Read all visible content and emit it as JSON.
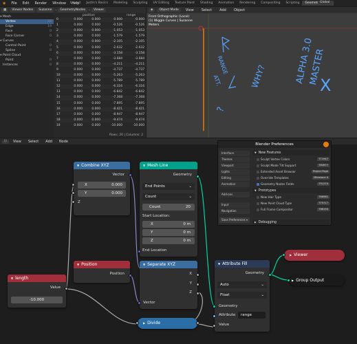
{
  "menubar": {
    "items": [
      "File",
      "Edit",
      "Render",
      "Window",
      "Help"
    ]
  },
  "workspace_tabs": [
    "Layout",
    "Justin's Basics",
    "Modeling",
    "Sculpting",
    "UV Editing",
    "Texture Paint",
    "Shading",
    "Animation",
    "Rendering",
    "Compositing",
    "Scripting",
    "Geometry Nodes"
  ],
  "scene": {
    "label": "Global"
  },
  "spreadsheet": {
    "editor": "Viewer Nodes",
    "object": "Suzanne",
    "node": "GeometryNodes",
    "viewer": "Viewer",
    "domains": [
      {
        "label": "Mesh",
        "group": true
      },
      {
        "label": "Vertex",
        "count": "20",
        "selected": true
      },
      {
        "label": "Edge",
        "count": "19"
      },
      {
        "label": "Face",
        "count": "0"
      },
      {
        "label": "Face Corner",
        "count": "0"
      },
      {
        "label": "Curves",
        "group": true
      },
      {
        "label": "Control Point",
        "count": "0"
      },
      {
        "label": "Spline",
        "count": "0"
      },
      {
        "label": "Point Cloud",
        "group": true
      },
      {
        "label": "Point",
        "count": "0"
      },
      {
        "label": "Instances",
        "count": "0"
      }
    ],
    "columns": [
      "position",
      "",
      "",
      "range"
    ],
    "rows": [
      [
        "0",
        "0.000",
        "0.000",
        "0.000",
        "-0.000"
      ],
      [
        "1",
        "0.000",
        "0.000",
        "-0.526",
        "-0.526"
      ],
      [
        "2",
        "0.000",
        "0.000",
        "-1.053",
        "-1.053"
      ],
      [
        "3",
        "0.000",
        "0.000",
        "-1.579",
        "-1.579"
      ],
      [
        "4",
        "0.000",
        "0.000",
        "-2.105",
        "-2.105"
      ],
      [
        "5",
        "0.000",
        "0.000",
        "-2.632",
        "-2.632"
      ],
      [
        "6",
        "0.000",
        "0.000",
        "-3.158",
        "-3.158"
      ],
      [
        "7",
        "0.000",
        "0.000",
        "-3.684",
        "-3.684"
      ],
      [
        "8",
        "0.000",
        "0.000",
        "-4.211",
        "-4.211"
      ],
      [
        "9",
        "0.000",
        "0.000",
        "-4.737",
        "-4.737"
      ],
      [
        "10",
        "0.000",
        "0.000",
        "-5.263",
        "-5.263"
      ],
      [
        "11",
        "0.000",
        "0.000",
        "-5.789",
        "-5.789"
      ],
      [
        "12",
        "0.000",
        "0.000",
        "-6.316",
        "-6.316"
      ],
      [
        "13",
        "0.000",
        "0.000",
        "-6.842",
        "-6.842"
      ],
      [
        "14",
        "0.000",
        "0.000",
        "-7.368",
        "-7.368"
      ],
      [
        "15",
        "0.000",
        "0.000",
        "-7.895",
        "-7.895"
      ],
      [
        "16",
        "0.000",
        "0.000",
        "-8.421",
        "-8.421"
      ],
      [
        "17",
        "0.000",
        "0.000",
        "-8.947",
        "-8.947"
      ],
      [
        "18",
        "0.000",
        "0.000",
        "-9.474",
        "-9.474"
      ],
      [
        "19",
        "0.000",
        "0.000",
        "-10.000",
        "-10.000"
      ]
    ],
    "footer": "Rows: 20  |  Columns: 2"
  },
  "viewport": {
    "header": [
      "Object Mode",
      "View",
      "Select",
      "Add",
      "Object"
    ],
    "info": [
      "Front Orthographic (Local)",
      "(1) Wiggle Curves | Suzanne",
      "Meters"
    ],
    "annotations": [
      "RANGE",
      "ATT.",
      "WHY?",
      "ALPHA 3.0",
      "MASTER",
      "X",
      "?"
    ]
  },
  "node_editor": {
    "header": [
      "View",
      "Select",
      "Add",
      "Node"
    ],
    "nodes": {
      "combine": {
        "title": "Combine XYZ",
        "out": "Vector",
        "x_label": "X",
        "x_val": "0.000",
        "y_label": "Y",
        "y_val": "0.000",
        "z_label": "Z"
      },
      "meshline": {
        "title": "Mesh Line",
        "out": "Geometry",
        "mode": "End Points",
        "count_mode": "Count",
        "count_label": "Count",
        "count_val": "20",
        "start_label": "Start Location:",
        "sx": "X",
        "sy": "Y",
        "sz": "Z",
        "sv": "0 m",
        "end": "End Location"
      },
      "position": {
        "title": "Position",
        "out": "Position"
      },
      "separate": {
        "title": "Separate XYZ",
        "x": "X",
        "y": "Y",
        "z": "Z",
        "in": "Vector"
      },
      "length": {
        "title": "length",
        "out": "Value",
        "val": "-10.000"
      },
      "attrfill": {
        "title": "Attribute Fill",
        "out": "Geometry",
        "type": "Auto",
        "dtype": "Float",
        "geo": "Geometry",
        "attr": "Attribute",
        "attr_val": "range",
        "value": "Value"
      },
      "divide": {
        "title": "Divide"
      },
      "viewer": {
        "title": "Viewer"
      },
      "group_output": {
        "title": "Group Output"
      }
    }
  },
  "prefs": {
    "title": "Blender Preferences",
    "nav": [
      "Interface",
      "Themes",
      "Viewport",
      "Lights",
      "Editing",
      "Animation",
      "Add-ons",
      "Input",
      "Navigation"
    ],
    "save": "Save Preferences",
    "sections": {
      "new": "New Features",
      "proto": "Prototypes",
      "debug": "Debugging"
    },
    "new_items": [
      {
        "label": "Sculpt Vertex Colors",
        "link": "T71947",
        "on": false
      },
      {
        "label": "Sculpt Mode Tilt Support",
        "link": "T82877",
        "on": false
      },
      {
        "label": "Extended Asset Browser",
        "link": "Project Page",
        "on": false
      },
      {
        "label": "Override Templates",
        "link": "Milestone 4",
        "on": false
      },
      {
        "label": "Geometry Nodes Fields",
        "link": "T91274",
        "on": true
      }
    ],
    "proto_items": [
      {
        "label": "New Hair Type",
        "link": "T68981",
        "on": false
      },
      {
        "label": "New Point Cloud Type",
        "link": "T75717",
        "on": false
      },
      {
        "label": "Full Frame Compositor",
        "link": "T88150",
        "on": false
      }
    ]
  },
  "colors": {
    "accent": "#4772b3",
    "vector_header": "#3b6ea0",
    "geo_header": "#00a28c",
    "input_header": "#a12f3b",
    "attr_header": "#2b3b57",
    "divide_header": "#2a6ea5",
    "viewer_header": "#a12f3b",
    "geo_socket": "#00d6a3",
    "vector_socket": "#6363c7",
    "float_socket": "#a1a1a1",
    "string_socket": "#70b2ff"
  }
}
